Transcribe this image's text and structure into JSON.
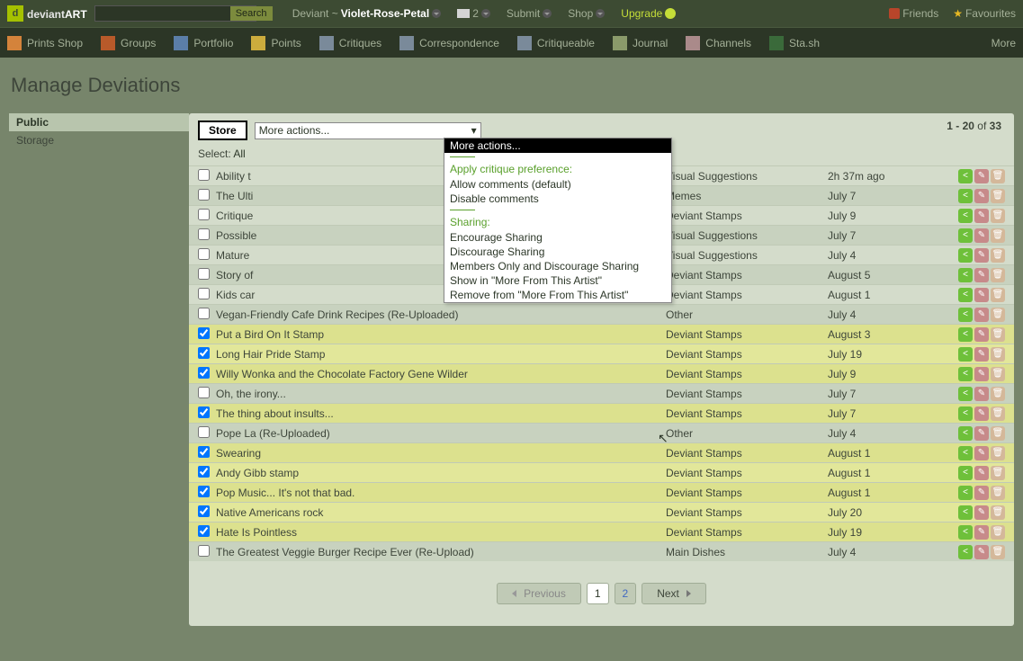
{
  "logo_text_1": "deviant",
  "logo_text_2": "ART",
  "search_placeholder": "",
  "search_btn": "Search",
  "top_nav": {
    "prefix": "Deviant ~",
    "username": "Violet-Rose-Petal",
    "msg_count": "2",
    "submit": "Submit",
    "shop": "Shop",
    "upgrade": "Upgrade"
  },
  "top_right": {
    "friends": "Friends",
    "favourites": "Favourites"
  },
  "navbar": [
    "Prints Shop",
    "Groups",
    "Portfolio",
    "Points",
    "Critiques",
    "Correspondence",
    "Critiqueable",
    "Journal",
    "Channels",
    "Sta.sh",
    "More"
  ],
  "page_title": "Manage Deviations",
  "sidebar": [
    {
      "label": "Public",
      "active": true
    },
    {
      "label": "Storage",
      "active": false
    }
  ],
  "store_btn": "Store",
  "actions_label": "More actions...",
  "page_info": {
    "range": "1 - 20",
    "of": " of ",
    "total": "33"
  },
  "select_label": "Select: ",
  "select_all": "All",
  "dropdown": {
    "selected": "More actions...",
    "h1": "Apply critique preference:",
    "i1": "Allow comments (default)",
    "i2": "Disable comments",
    "h2": "Sharing:",
    "i3": "Encourage Sharing",
    "i4": "Discourage Sharing",
    "i5": "Members Only and Discourage Sharing",
    "i6": "Show in \"More From This Artist\"",
    "i7": "Remove from \"More From This Artist\""
  },
  "rows": [
    {
      "checked": false,
      "title": "Ability t",
      "category": "Visual Suggestions",
      "date": "2h 37m ago"
    },
    {
      "checked": false,
      "title": "The Ulti",
      "category": "Memes",
      "date": "July 7"
    },
    {
      "checked": false,
      "title": "Critique",
      "category": "Deviant Stamps",
      "date": "July 9"
    },
    {
      "checked": false,
      "title": "Possible",
      "category": "Visual Suggestions",
      "date": "July 7"
    },
    {
      "checked": false,
      "title": "Mature",
      "category": "Visual Suggestions",
      "date": "July 4"
    },
    {
      "checked": false,
      "title": "Story of",
      "category": "Deviant Stamps",
      "date": "August 5"
    },
    {
      "checked": false,
      "title": "Kids car",
      "category": "Deviant Stamps",
      "date": "August 1"
    },
    {
      "checked": false,
      "title": "Vegan-Friendly Cafe Drink Recipes (Re-Uploaded)",
      "category": "Other",
      "date": "July 4"
    },
    {
      "checked": true,
      "title": "Put a Bird On It Stamp",
      "category": "Deviant Stamps",
      "date": "August 3"
    },
    {
      "checked": true,
      "title": "Long Hair Pride Stamp",
      "category": "Deviant Stamps",
      "date": "July 19"
    },
    {
      "checked": true,
      "title": "Willy Wonka and the Chocolate Factory Gene Wilder",
      "category": "Deviant Stamps",
      "date": "July 9"
    },
    {
      "checked": false,
      "title": "Oh, the irony...",
      "category": "Deviant Stamps",
      "date": "July 7"
    },
    {
      "checked": true,
      "title": "The thing about insults...",
      "category": "Deviant Stamps",
      "date": "July 7"
    },
    {
      "checked": false,
      "title": "Pope La (Re-Uploaded)",
      "category": "Other",
      "date": "July 4"
    },
    {
      "checked": true,
      "title": "Swearing",
      "category": "Deviant Stamps",
      "date": "August 1"
    },
    {
      "checked": true,
      "title": "Andy Gibb stamp",
      "category": "Deviant Stamps",
      "date": "August 1"
    },
    {
      "checked": true,
      "title": "Pop Music... It's not that bad.",
      "category": "Deviant Stamps",
      "date": "August 1"
    },
    {
      "checked": true,
      "title": "Native Americans rock",
      "category": "Deviant Stamps",
      "date": "July 20"
    },
    {
      "checked": true,
      "title": "Hate Is Pointless",
      "category": "Deviant Stamps",
      "date": "July 19"
    },
    {
      "checked": false,
      "title": "The Greatest Veggie Burger Recipe Ever (Re-Upload)",
      "category": "Main Dishes",
      "date": "July 4"
    }
  ],
  "pagination": {
    "prev": "Previous",
    "p1": "1",
    "p2": "2",
    "next": "Next"
  }
}
